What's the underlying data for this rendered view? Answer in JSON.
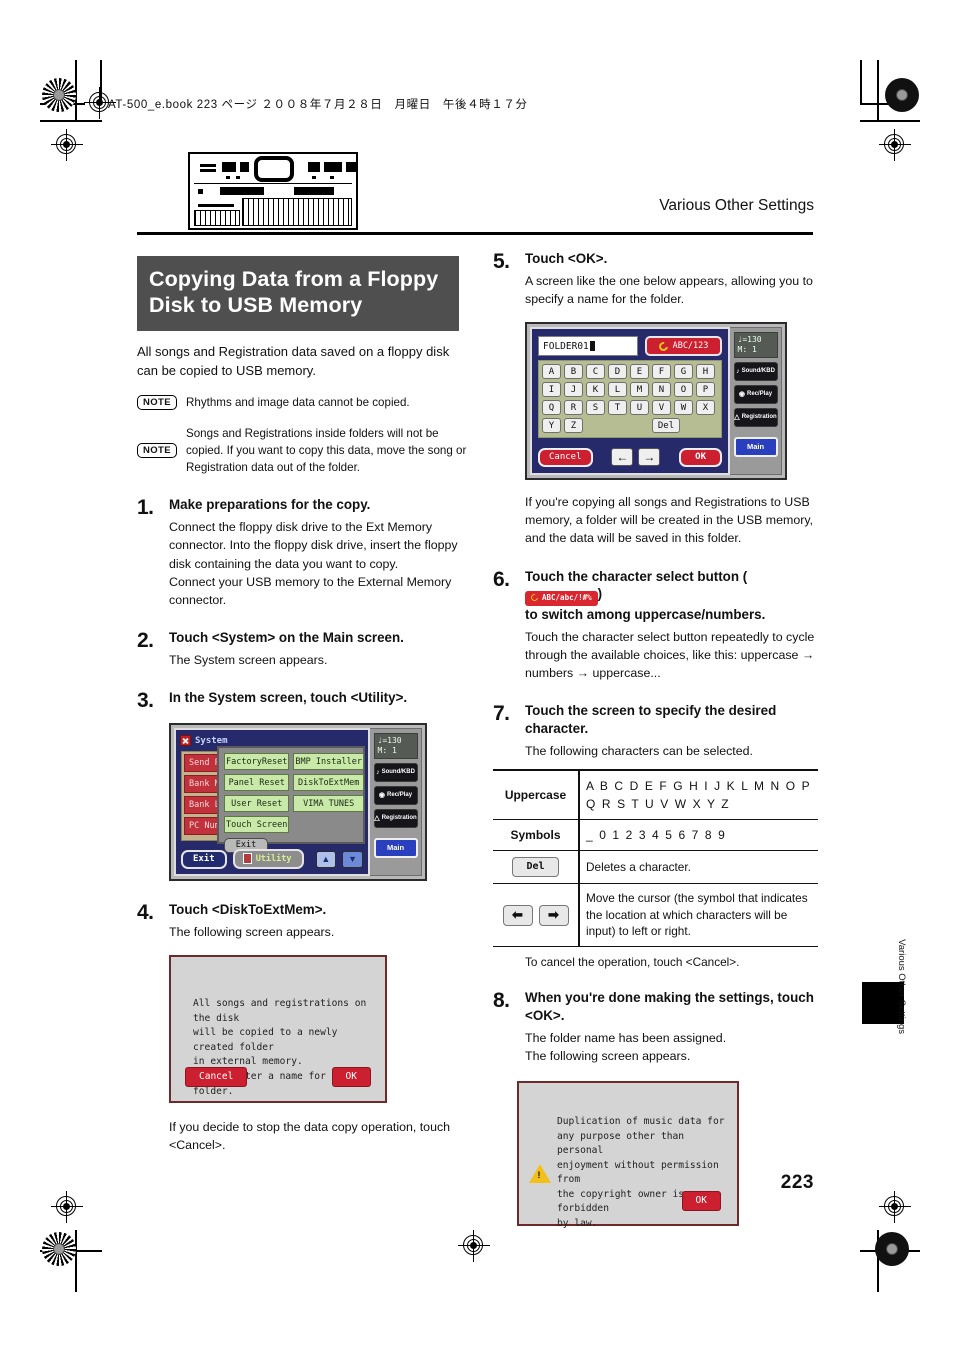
{
  "page": {
    "header_line": "AT-500_e.book  223 ページ  ２００８年７月２８日　月曜日　午後４時１７分",
    "running_head": "Various Other Settings",
    "folio": "223",
    "side_tab_label": "Various Other Settings"
  },
  "section": {
    "title_line1": "Copying Data from a Floppy",
    "title_line2": "Disk to USB Memory",
    "title_bg": "#4f4f4f",
    "intro": "All songs and Registration data saved on a floppy disk can be copied to USB memory."
  },
  "notes": [
    {
      "badge": "NOTE",
      "text": "Rhythms and image data cannot be copied."
    },
    {
      "badge": "NOTE",
      "text": "Songs and Registrations inside folders will not be copied. If you want to copy this data, move the song or Registration data out of the folder."
    }
  ],
  "steps": {
    "s1": {
      "num": "1.",
      "head": "Make preparations for the copy.",
      "body1": "Connect the floppy disk drive to the Ext Memory connector. Into the floppy disk drive, insert the floppy disk containing the data you want to copy.",
      "body2": "Connect your USB memory to the External Memory connector."
    },
    "s2": {
      "num": "2.",
      "head": "Touch <System> on the Main screen.",
      "body": "The System screen appears."
    },
    "s3": {
      "num": "3.",
      "head": "In the System screen, touch <Utility>."
    },
    "s4": {
      "num": "4.",
      "head": "Touch <DiskToExtMem>.",
      "body": "The following screen appears.",
      "after": "If you decide to stop the data copy operation, touch <Cancel>."
    },
    "s5": {
      "num": "5.",
      "head": "Touch <OK>.",
      "body": "A screen like the one below appears, allowing you to specify a name for the folder.",
      "after": "If you're copying all songs and Registrations to USB memory, a folder will be created in the USB memory, and the data will be saved in this folder."
    },
    "s6": {
      "num": "6.",
      "head_before": "Touch the character select button (",
      "head_after": ")",
      "head_line2": "to switch among uppercase/numbers.",
      "inline_button_label": "ABC/abc/!#%",
      "body": "Touch the character select button repeatedly to cycle through the available choices, like this: uppercase → numbers → uppercase..."
    },
    "s7": {
      "num": "7.",
      "head": "Touch the screen to specify the desired character.",
      "body": "The following characters can be selected.",
      "after": "To cancel the operation, touch <Cancel>."
    },
    "s8": {
      "num": "8.",
      "head": "When you're done making the settings, touch <OK>.",
      "body1": "The folder name has been assigned.",
      "body2": "The following screen appears."
    }
  },
  "system_screen": {
    "title": "System",
    "list_rows": [
      "Send PC",
      "Bank MSB",
      "Bank LSB",
      "PC Number"
    ],
    "popup_buttons": [
      "FactoryReset",
      "BMP Installer",
      "Panel Reset",
      "DiskToExtMem",
      "User Reset",
      "VIMA TUNES",
      "Touch Screen"
    ],
    "popup_exit": "Exit",
    "bottom_exit": "Exit",
    "bottom_utility": "Utility",
    "tempo": "♩=130",
    "measure": "M:    1",
    "side_buttons": [
      "Sound/KBD",
      "Rec/Play",
      "Registration"
    ],
    "main_button": "Main"
  },
  "keyboard_screen": {
    "folder_name": "FOLDER01",
    "charsel_label": "ABC/123",
    "rows": [
      [
        "A",
        "B",
        "C",
        "D",
        "E",
        "F",
        "G",
        "H"
      ],
      [
        "I",
        "J",
        "K",
        "L",
        "M",
        "N",
        "O",
        "P"
      ],
      [
        "Q",
        "R",
        "S",
        "T",
        "U",
        "V",
        "W",
        "X"
      ],
      [
        "Y",
        "Z"
      ]
    ],
    "del_label": "Del",
    "cancel_label": "Cancel",
    "ok_label": "OK",
    "left_arrow": "←",
    "right_arrow": "→",
    "tempo": "♩=130",
    "measure": "M:    1",
    "side_buttons": [
      "Sound/KBD",
      "Rec/Play",
      "Registration"
    ],
    "main_button": "Main"
  },
  "dialog_copy": {
    "lines": [
      "All songs and registrations on the disk",
      "will be copied to a newly created folder",
      "in external memory.",
      "Please enter a name for the folder."
    ],
    "cancel_label": "Cancel",
    "ok_label": "OK"
  },
  "dialog_copyright": {
    "lines": [
      "Duplication of music data for",
      "any purpose other than personal",
      "enjoyment without permission from",
      "the copyright owner is forbidden",
      "by law."
    ],
    "ok_label": "OK"
  },
  "char_table": {
    "rows": [
      {
        "label": "Uppercase",
        "value": "A B C D E F G H I J K L M N O P Q R S T U V W X Y Z"
      },
      {
        "label": "Symbols",
        "value": "_ 0 1 2 3 4 5 6 7 8 9"
      },
      {
        "label_key": "Del",
        "value": "Deletes a character."
      },
      {
        "label_arrows": "← →",
        "value": "Move the cursor (the symbol that indicates the location at which characters will be input) to left or right."
      }
    ]
  }
}
